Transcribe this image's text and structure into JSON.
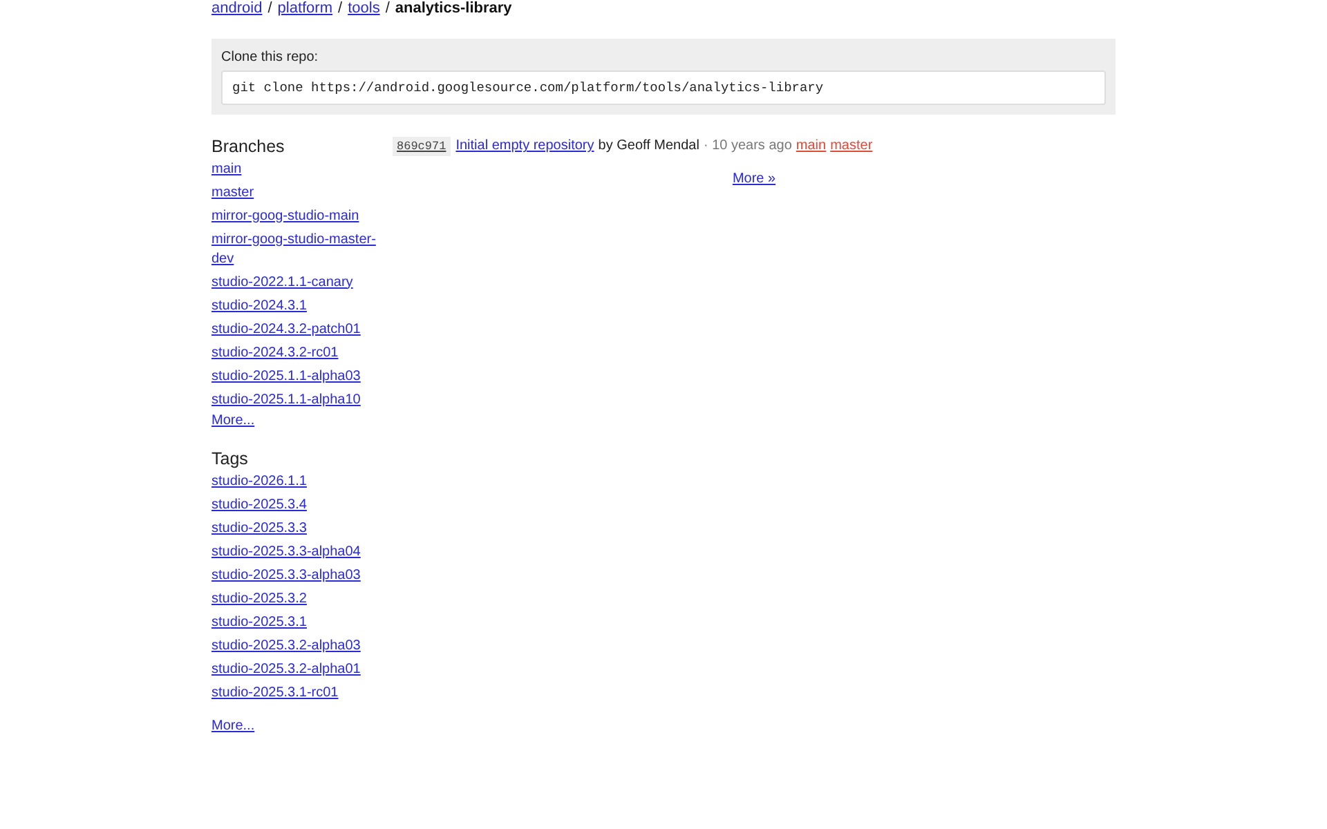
{
  "breadcrumb": [
    {
      "kind": "link",
      "label": "android"
    },
    {
      "kind": "separator",
      "label": "/"
    },
    {
      "kind": "link",
      "label": "platform"
    },
    {
      "kind": "separator",
      "label": "/"
    },
    {
      "kind": "link",
      "label": "tools"
    },
    {
      "kind": "separator",
      "label": "/"
    },
    {
      "kind": "current",
      "label": "analytics-library"
    }
  ],
  "clone": {
    "label": "Clone this repo:",
    "command": "git clone https://android.googlesource.com/platform/tools/analytics-library"
  },
  "branches": {
    "title": "Branches",
    "items": [
      "main",
      "master",
      "mirror-goog-studio-main",
      "mirror-goog-studio-master-dev",
      "studio-2022.1.1-canary",
      "studio-2024.3.1",
      "studio-2024.3.2-patch01",
      "studio-2024.3.2-rc01",
      "studio-2025.1.1-alpha03",
      "studio-2025.1.1-alpha10"
    ],
    "more": "More..."
  },
  "tags": {
    "title": "Tags",
    "items": [
      "studio-2026.1.1",
      "studio-2025.3.4",
      "studio-2025.3.3",
      "studio-2025.3.3-alpha04",
      "studio-2025.3.3-alpha03",
      "studio-2025.3.2",
      "studio-2025.3.1",
      "studio-2025.3.2-alpha03",
      "studio-2025.3.2-alpha01",
      "studio-2025.3.1-rc01"
    ],
    "more": "More..."
  },
  "log": {
    "commits": [
      {
        "hash": "869c971",
        "message": "Initial empty repository",
        "author": "by Geoff Mendal",
        "time": "· 10 years ago",
        "refs": [
          "main",
          "master"
        ]
      }
    ],
    "more": "More »"
  }
}
